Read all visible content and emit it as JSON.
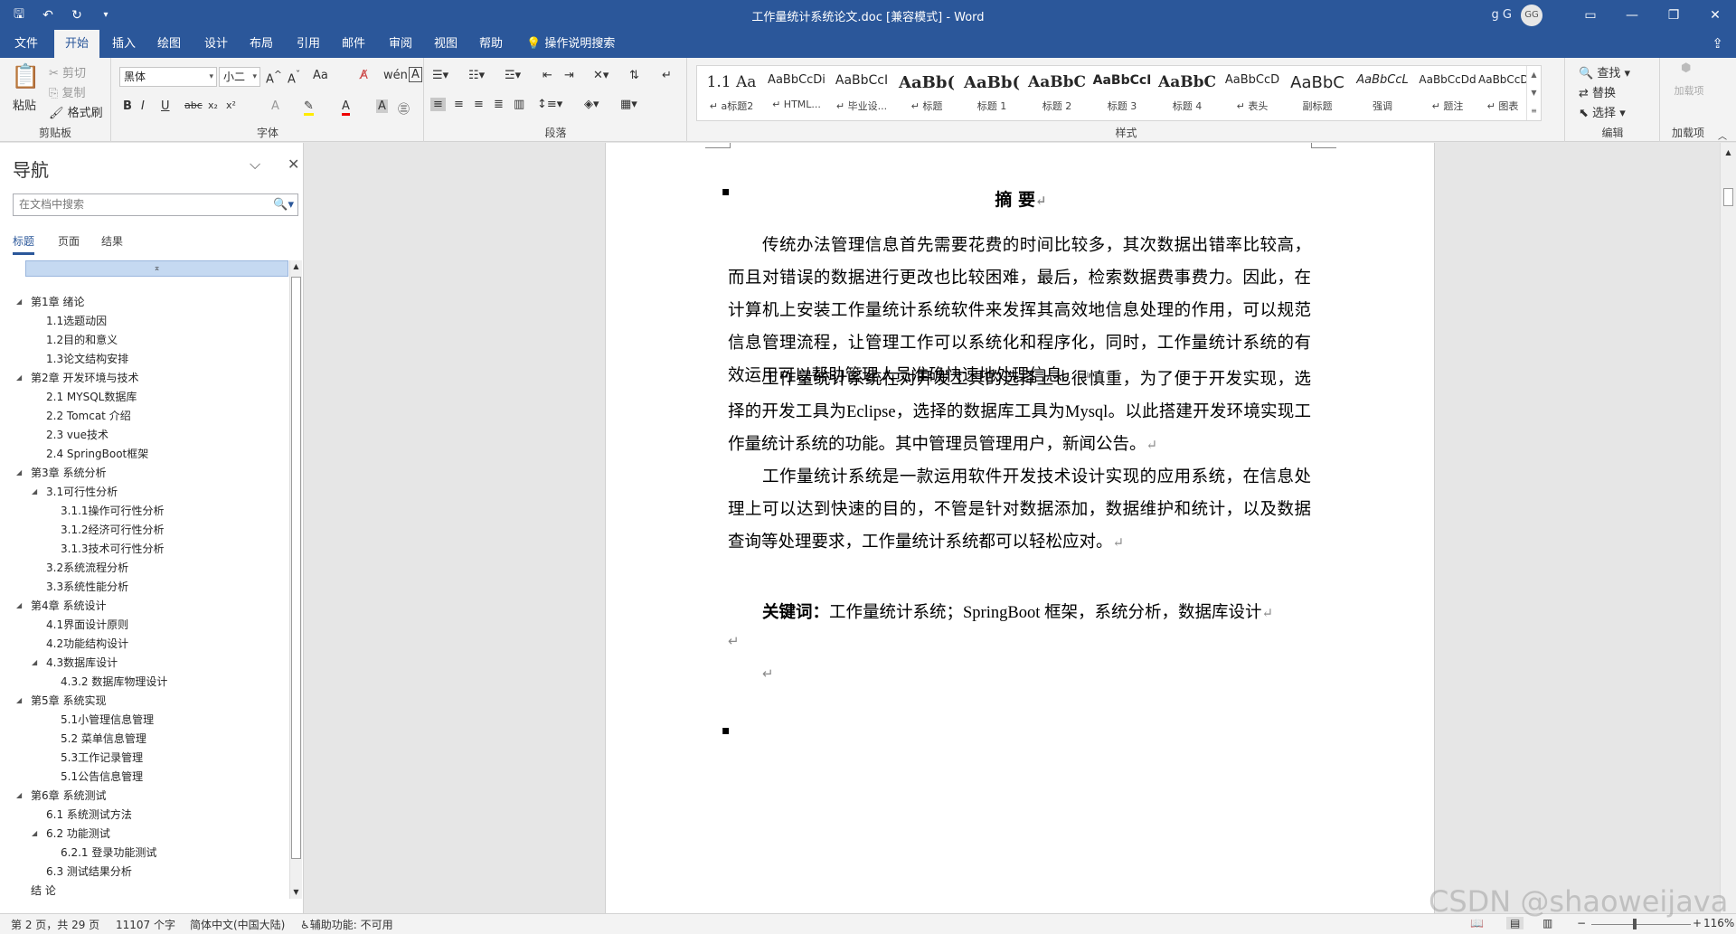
{
  "title_bar": {
    "title": "工作量统计系统论文.doc [兼容模式]  -  Word",
    "user": "g G",
    "avatar_initials": "GG",
    "qat": {
      "save_icon": "save-icon",
      "undo_icon": "undo-icon",
      "redo_icon": "redo-icon",
      "customize_icon": "customize-icon"
    }
  },
  "ribbon_tabs": {
    "items": [
      "文件",
      "开始",
      "插入",
      "绘图",
      "设计",
      "布局",
      "引用",
      "邮件",
      "审阅",
      "视图",
      "帮助"
    ],
    "active": "开始",
    "tell_me": "操作说明搜索"
  },
  "ribbon": {
    "clipboard": {
      "paste": "粘贴",
      "cut": "剪切",
      "copy": "复制",
      "format_painter": "格式刷",
      "label": "剪贴板"
    },
    "font": {
      "name": "黑体",
      "size": "小二",
      "change_case": "Aa",
      "label": "字体"
    },
    "paragraph": {
      "label": "段落"
    },
    "styles": {
      "label": "样式",
      "items": [
        {
          "sample": "1.1  Aa",
          "name": "↵ a标题2"
        },
        {
          "sample": "AaBbCcDi",
          "name": "↵ HTML..."
        },
        {
          "sample": "AaBbCcI",
          "name": "↵ 毕业设..."
        },
        {
          "sample": "AaBb(",
          "name": "↵ 标题"
        },
        {
          "sample": "AaBb(",
          "name": "标题 1"
        },
        {
          "sample": "AaBbC",
          "name": "标题 2"
        },
        {
          "sample": "AaBbCcI",
          "name": "标题 3"
        },
        {
          "sample": "AaBbC",
          "name": "标题 4"
        },
        {
          "sample": "AaBbCcD",
          "name": "↵ 表头"
        },
        {
          "sample": "AaBbC",
          "name": "副标题"
        },
        {
          "sample": "AaBbCcL",
          "name": "强调"
        },
        {
          "sample": "AaBbCcDd",
          "name": "↵ 题注"
        },
        {
          "sample": "AaBbCcD",
          "name": "↵ 图表"
        }
      ]
    },
    "editing": {
      "find": "查找",
      "replace": "替换",
      "select": "选择",
      "label": "编辑"
    },
    "addins": {
      "button": "加载项",
      "label": "加载项"
    }
  },
  "nav": {
    "title": "导航",
    "search_placeholder": "在文档中搜索",
    "tabs": [
      "标题",
      "页面",
      "结果"
    ],
    "active_tab": "标题",
    "items": [
      {
        "text": "第1章 绪论",
        "level": 1,
        "expanded": true
      },
      {
        "text": "1.1选题动因",
        "level": 2
      },
      {
        "text": "1.2目的和意义",
        "level": 2
      },
      {
        "text": "1.3论文结构安排",
        "level": 2
      },
      {
        "text": "第2章 开发环境与技术",
        "level": 1,
        "expanded": true
      },
      {
        "text": "2.1 MYSQL数据库",
        "level": 2
      },
      {
        "text": "2.2 Tomcat 介绍",
        "level": 2
      },
      {
        "text": "2.3 vue技术",
        "level": 2
      },
      {
        "text": "2.4 SpringBoot框架",
        "level": 2
      },
      {
        "text": "第3章 系统分析",
        "level": 1,
        "expanded": true
      },
      {
        "text": "3.1可行性分析",
        "level": 2,
        "expanded": true
      },
      {
        "text": "3.1.1操作可行性分析",
        "level": 3
      },
      {
        "text": "3.1.2经济可行性分析",
        "level": 3
      },
      {
        "text": "3.1.3技术可行性分析",
        "level": 3
      },
      {
        "text": "3.2系统流程分析",
        "level": 2
      },
      {
        "text": "3.3系统性能分析",
        "level": 2
      },
      {
        "text": "第4章 系统设计",
        "level": 1,
        "expanded": true
      },
      {
        "text": "4.1界面设计原则",
        "level": 2
      },
      {
        "text": "4.2功能结构设计",
        "level": 2
      },
      {
        "text": "4.3数据库设计",
        "level": 2,
        "expanded": true
      },
      {
        "text": "4.3.2 数据库物理设计",
        "level": 3
      },
      {
        "text": "第5章 系统实现",
        "level": 1,
        "expanded": true
      },
      {
        "text": "5.1小管理信息管理",
        "level": 3
      },
      {
        "text": "5.2 菜单信息管理",
        "level": 3
      },
      {
        "text": "5.3工作记录管理",
        "level": 3
      },
      {
        "text": "5.1公告信息管理",
        "level": 3
      },
      {
        "text": "第6章 系统测试",
        "level": 1,
        "expanded": true
      },
      {
        "text": "6.1 系统测试方法",
        "level": 2
      },
      {
        "text": "6.2 功能测试",
        "level": 2,
        "expanded": true
      },
      {
        "text": "6.2.1 登录功能测试",
        "level": 3
      },
      {
        "text": "6.3 测试结果分析",
        "level": 2
      },
      {
        "text": "结  论",
        "level": 1
      }
    ]
  },
  "document": {
    "heading": "摘  要",
    "paragraphs": [
      "传统办法管理信息首先需要花费的时间比较多，其次数据出错率比较高，而且对错误的数据进行更改也比较困难，最后，检索数据费事费力。因此，在计算机上安装工作量统计系统软件来发挥其高效地信息处理的作用，可以规范信息管理流程，让管理工作可以系统化和程序化，同时，工作量统计系统的有效运用可以帮助管理人员准确快速地处理信息。",
      "工作量统计系统在对开发工具的选择上也很慎重，为了便于开发实现，选择的开发工具为Eclipse，选择的数据库工具为Mysql。以此搭建开发环境实现工作量统计系统的功能。其中管理员管理用户，新闻公告。",
      "工作量统计系统是一款运用软件开发技术设计实现的应用系统，在信息处理上可以达到快速的目的，不管是针对数据添加，数据维护和统计，以及数据查询等处理要求，工作量统计系统都可以轻松应对。"
    ],
    "keywords_label": "关键词：",
    "keywords": "工作量统计系统；SpringBoot 框架，系统分析，数据库设计",
    "paragraph_mark": "↵",
    "bullet": "▪"
  },
  "status_bar": {
    "page": "第 2 页，共 29 页",
    "words": "11107 个字",
    "language": "简体中文(中国大陆)",
    "accessibility": "辅助功能: 不可用",
    "zoom": "116%"
  },
  "watermark": "CSDN @shaoweijava"
}
